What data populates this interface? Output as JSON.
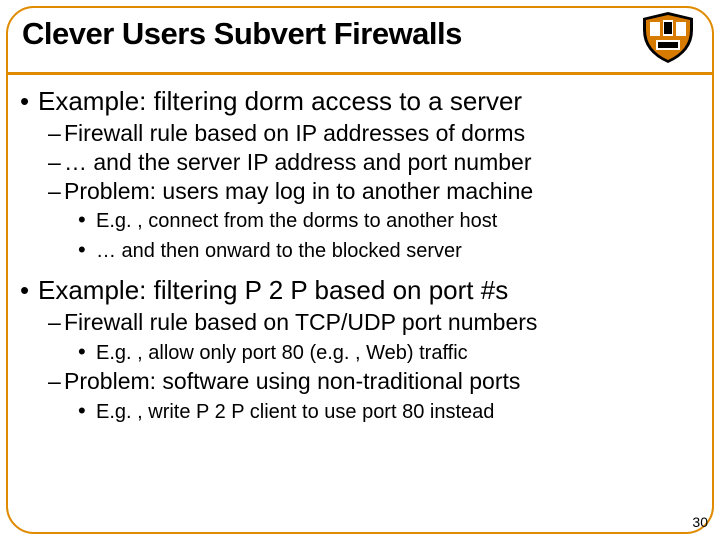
{
  "title": "Clever Users Subvert Firewalls",
  "sections": [
    {
      "heading": "Example: filtering dorm access to a server",
      "subs": [
        "Firewall rule based on IP addresses of dorms",
        "… and the server IP address and port number",
        "Problem: users may log in to another machine"
      ],
      "subsubs": [
        "E.g. , connect from the dorms to another host",
        "… and then onward to the blocked server"
      ]
    },
    {
      "heading": "Example: filtering P 2 P based on port #s",
      "subs1": [
        "Firewall rule based on TCP/UDP port numbers"
      ],
      "subsubs1": [
        "E.g. , allow only port 80 (e.g. , Web) traffic"
      ],
      "subs2": [
        "Problem: software using non-traditional ports"
      ],
      "subsubs2": [
        "E.g. , write P 2 P client to use port 80 instead"
      ]
    }
  ],
  "page_number": "30"
}
